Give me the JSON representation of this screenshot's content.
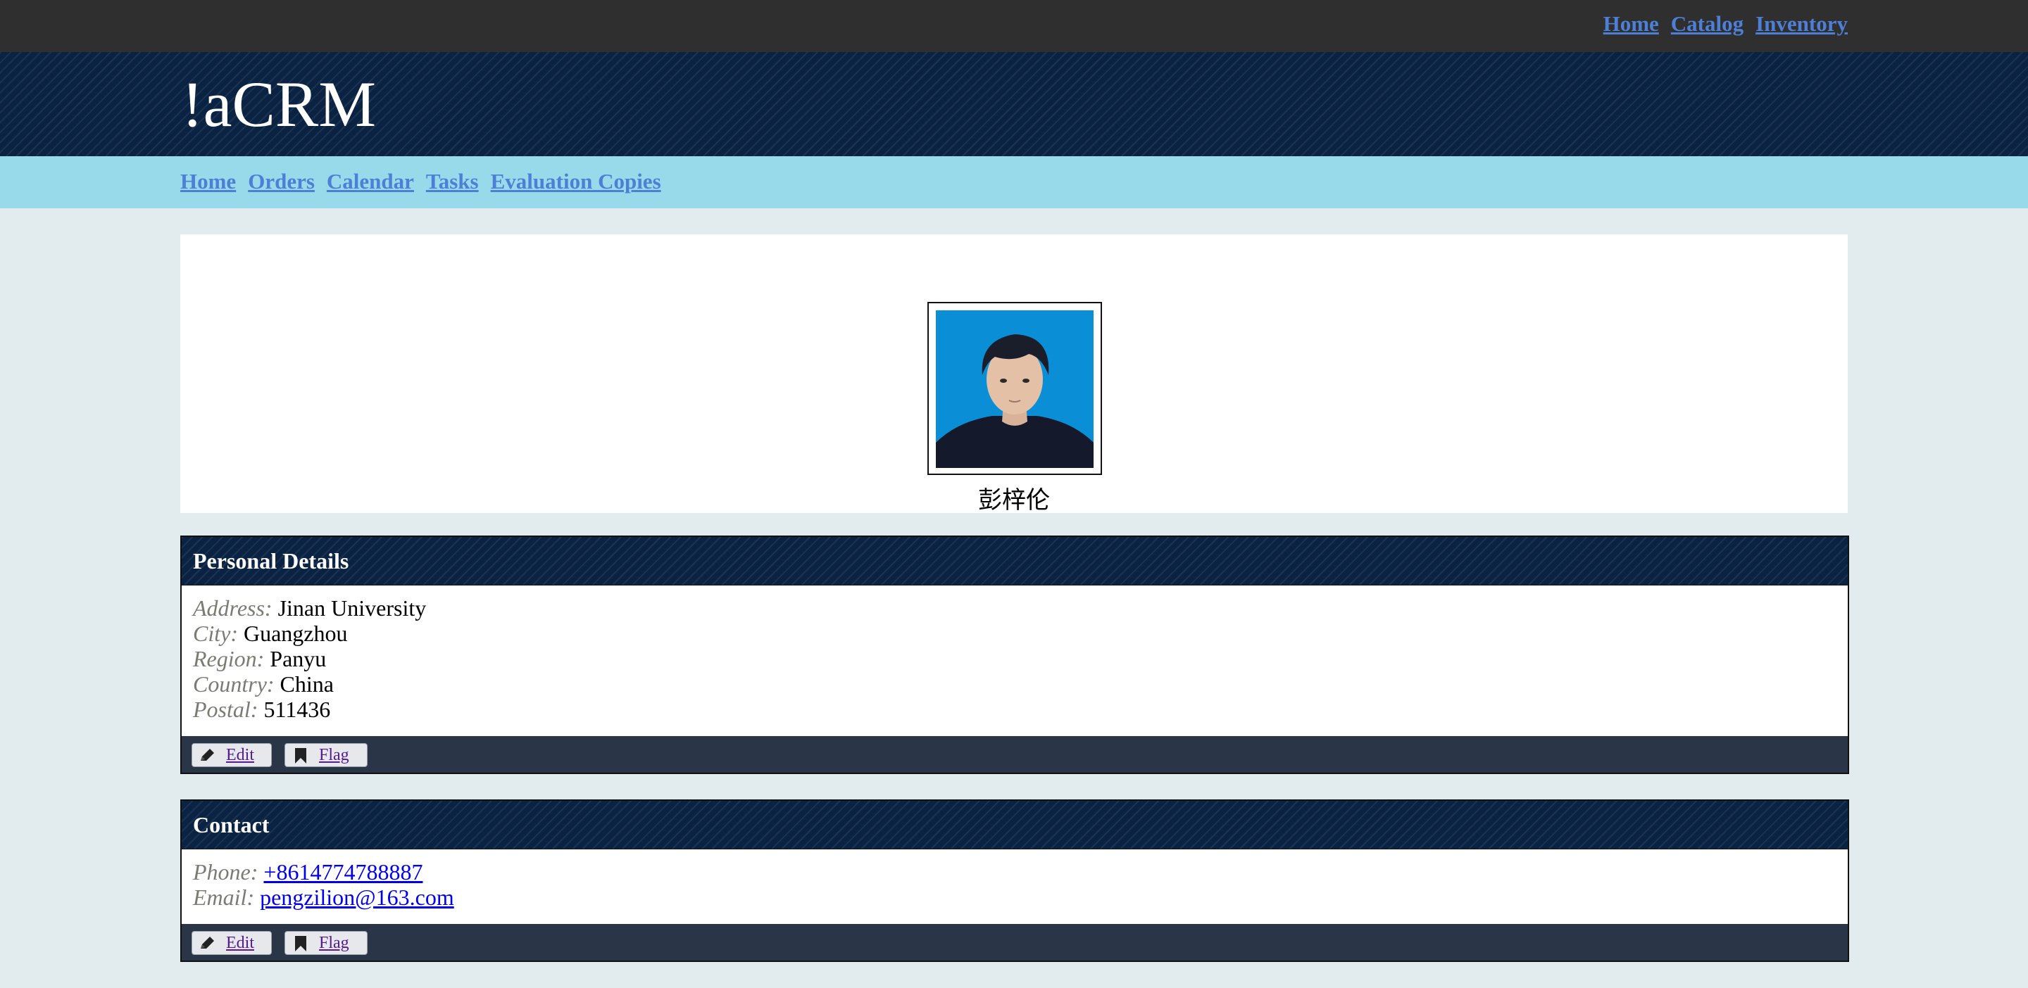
{
  "top_nav": {
    "home": "Home",
    "catalog": "Catalog",
    "inventory": "Inventory"
  },
  "brand": {
    "title": "!aCRM"
  },
  "main_nav": {
    "home": "Home",
    "orders": "Orders",
    "calendar": "Calendar",
    "tasks": "Tasks",
    "evaluation_copies": "Evaluation Copies"
  },
  "profile": {
    "name": "彭梓伦",
    "photo_icon": "person-portrait"
  },
  "personal_details": {
    "title": "Personal Details",
    "address_label": "Address:",
    "address_value": "Jinan University",
    "city_label": "City:",
    "city_value": "Guangzhou",
    "region_label": "Region:",
    "region_value": "Panyu",
    "country_label": "Country:",
    "country_value": "China",
    "postal_label": "Postal:",
    "postal_value": "511436",
    "edit_label": "Edit",
    "flag_label": "Flag"
  },
  "contact": {
    "title": "Contact",
    "phone_label": "Phone:",
    "phone_value": "+8614774788887",
    "email_label": "Email:",
    "email_value": "pengzilion@163.com",
    "edit_label": "Edit",
    "flag_label": "Flag"
  },
  "colors": {
    "topbar": "#2f2f2f",
    "banner": "#0b2343",
    "navbar": "#98d9ea",
    "page_bg": "#e2ecef",
    "nav_link": "#4e7fd6",
    "panel_footer": "#2a3547",
    "photo_bg": "#0a8fd6"
  }
}
